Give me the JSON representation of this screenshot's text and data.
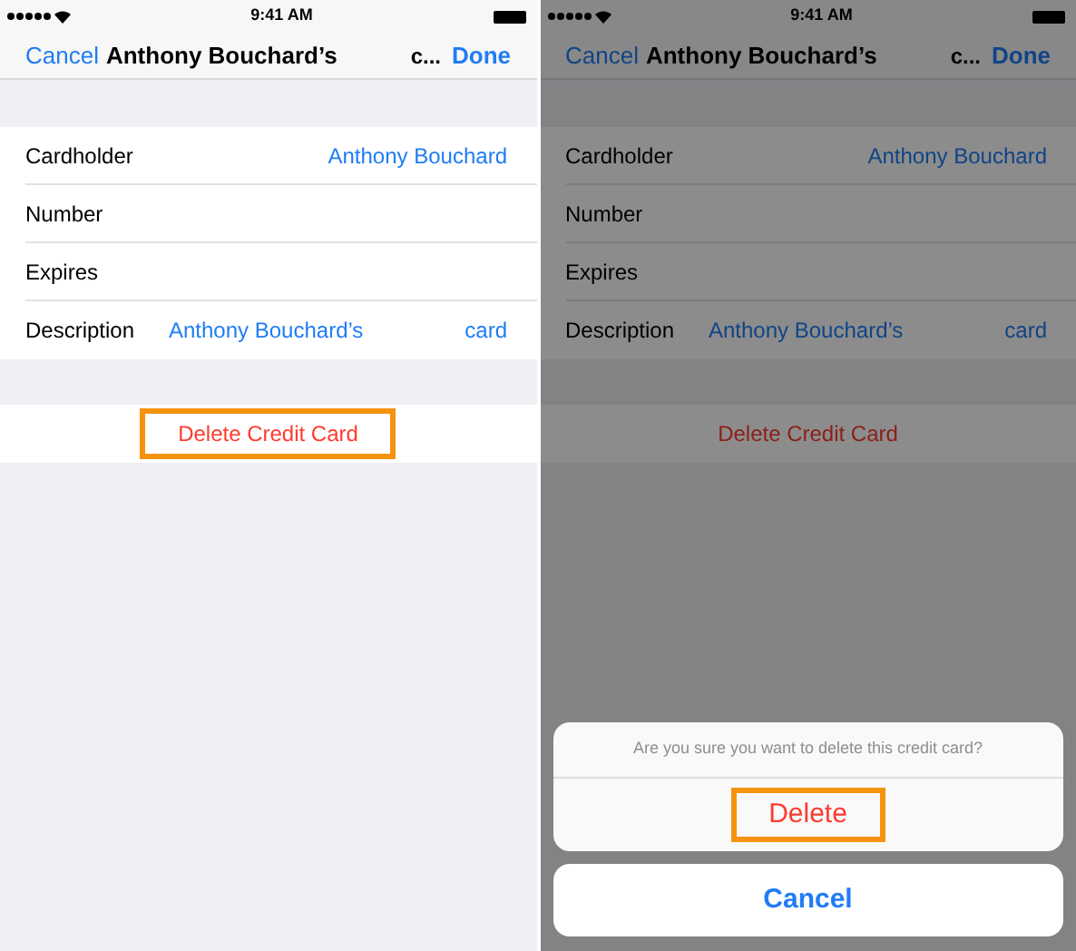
{
  "screens": [
    {
      "dimmed": false,
      "status_bar": {
        "time": "9:41 AM"
      },
      "nav": {
        "cancel": "Cancel",
        "title": "Anthony Bouchard’s",
        "title_2": "c...",
        "done": "Done"
      },
      "rows": [
        {
          "label": "Cardholder",
          "value": "Anthony Bouchard"
        },
        {
          "label": "Number"
        },
        {
          "label": "Expires"
        },
        {
          "label": "Description",
          "value": "Anthony Bouchard’s",
          "value_2": "card"
        }
      ],
      "delete_button": {
        "label": "Delete Credit Card",
        "highlighted": true
      }
    },
    {
      "dimmed": true,
      "status_bar": {
        "time": "9:41 AM"
      },
      "nav": {
        "cancel": "Cancel",
        "title": "Anthony Bouchard’s",
        "title_2": "c...",
        "done": "Done"
      },
      "rows": [
        {
          "label": "Cardholder",
          "value": "Anthony Bouchard"
        },
        {
          "label": "Number"
        },
        {
          "label": "Expires"
        },
        {
          "label": "Description",
          "value": "Anthony Bouchard’s",
          "value_2": "card"
        }
      ],
      "delete_button": {
        "label": "Delete Credit Card",
        "highlighted": false
      },
      "action_sheet": {
        "message": "Are you sure you want to delete this credit card?",
        "delete": {
          "label": "Delete",
          "highlighted": true
        },
        "cancel": "Cancel"
      }
    }
  ]
}
